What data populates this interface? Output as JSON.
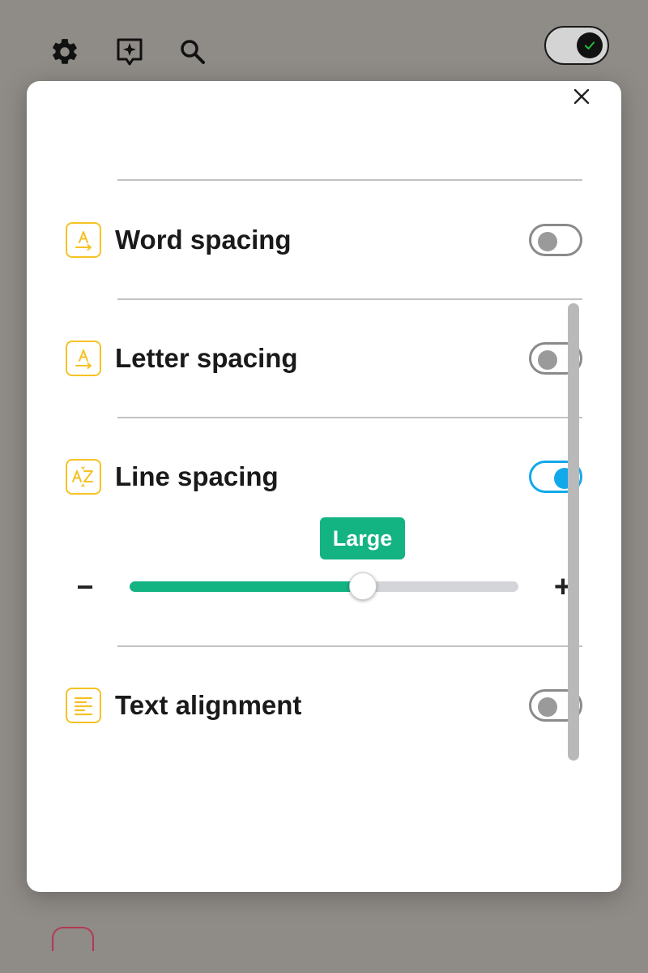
{
  "toolbar": {
    "icons": [
      "gear-icon",
      "sparkle-bookmark-icon",
      "search-icon"
    ],
    "master_toggle": {
      "state": "on",
      "icon": "check-icon"
    }
  },
  "modal": {
    "close_icon": "close-icon",
    "rows": [
      {
        "key": "word_spacing",
        "label": "Word spacing",
        "icon": "letter-a-arrow-icon",
        "enabled": false
      },
      {
        "key": "letter_spacing",
        "label": "Letter spacing",
        "icon": "letter-a-arrow-icon",
        "enabled": false
      },
      {
        "key": "line_spacing",
        "label": "Line spacing",
        "icon": "a-z-spacing-icon",
        "enabled": true
      },
      {
        "key": "text_alignment",
        "label": "Text alignment",
        "icon": "align-left-icon",
        "enabled": false
      }
    ],
    "line_spacing_slider": {
      "value_label": "Large",
      "fraction": 0.6,
      "decrease_symbol": "−",
      "increase_symbol": "+"
    }
  },
  "colors": {
    "backdrop": "#8f8b87",
    "accent_green": "#13b382",
    "toggle_on_blue": "#12a9ea",
    "icon_yellow": "#f5c224"
  }
}
